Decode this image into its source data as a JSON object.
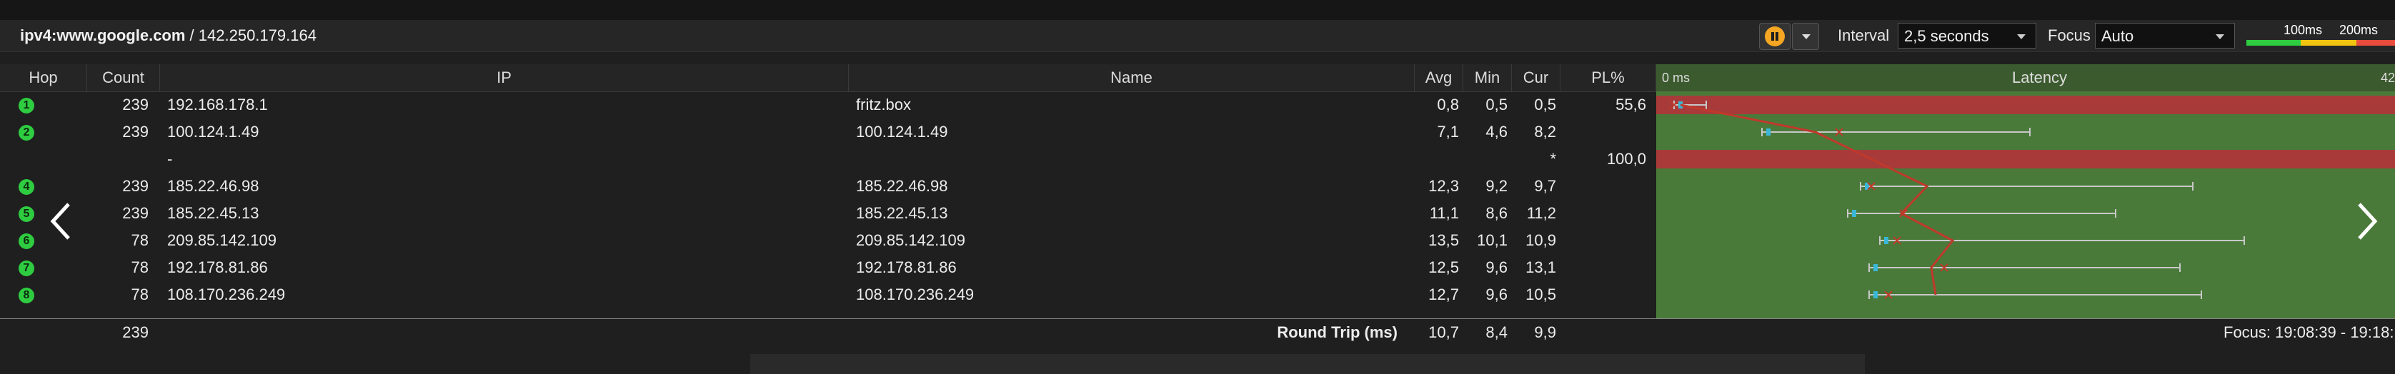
{
  "header": {
    "target_prefix": "ipv4:www.google.com",
    "target_ip": " / 142.250.179.164",
    "interval_label": "Interval",
    "interval_value": "2,5 seconds",
    "focus_label": "Focus",
    "focus_value": "Auto",
    "legend_100": "100ms",
    "legend_200": "200ms"
  },
  "columns": {
    "hop": "Hop",
    "count": "Count",
    "ip": "IP",
    "name": "Name",
    "avg": "Avg",
    "min": "Min",
    "cur": "Cur",
    "pl": "PL%",
    "graph_start": "0 ms",
    "latency": "Latency",
    "graph_end": "42"
  },
  "rows": [
    {
      "hop": "1",
      "count": "239",
      "ip": "192.168.178.1",
      "name": "fritz.box",
      "avg": "0,8",
      "min": "0,5",
      "cur": "0,5",
      "pl": "55,6"
    },
    {
      "hop": "2",
      "count": "239",
      "ip": "100.124.1.49",
      "name": "100.124.1.49",
      "avg": "7,1",
      "min": "4,6",
      "cur": "8,2",
      "pl": ""
    },
    {
      "hop": "",
      "count": "",
      "ip": "-",
      "name": "",
      "avg": "",
      "min": "",
      "cur": "*",
      "pl": "100,0"
    },
    {
      "hop": "4",
      "count": "239",
      "ip": "185.22.46.98",
      "name": "185.22.46.98",
      "avg": "12,3",
      "min": "9,2",
      "cur": "9,7",
      "pl": ""
    },
    {
      "hop": "5",
      "count": "239",
      "ip": "185.22.45.13",
      "name": "185.22.45.13",
      "avg": "11,1",
      "min": "8,6",
      "cur": "11,2",
      "pl": ""
    },
    {
      "hop": "6",
      "count": "78",
      "ip": "209.85.142.109",
      "name": "209.85.142.109",
      "avg": "13,5",
      "min": "10,1",
      "cur": "10,9",
      "pl": ""
    },
    {
      "hop": "7",
      "count": "78",
      "ip": "192.178.81.86",
      "name": "192.178.81.86",
      "avg": "12,5",
      "min": "9,6",
      "cur": "13,1",
      "pl": ""
    },
    {
      "hop": "8",
      "count": "78",
      "ip": "108.170.236.249",
      "name": "108.170.236.249",
      "avg": "12,7",
      "min": "9,6",
      "cur": "10,5",
      "pl": ""
    }
  ],
  "footer": {
    "count": "239",
    "label": "Round Trip (ms)",
    "avg": "10,7",
    "min": "8,4",
    "cur": "9,9",
    "focus": "Focus: 19:08:39 - 19:18:"
  },
  "colors": {
    "graph_bg": "#4a7a3a",
    "loss_bar": "#a83a3a",
    "avg_line": "#c0392b",
    "jitter": "#c8c8c8",
    "min_marker": "#3ab7d6",
    "hop_dot": "#2ecc40",
    "pause": "#f5a623"
  }
}
